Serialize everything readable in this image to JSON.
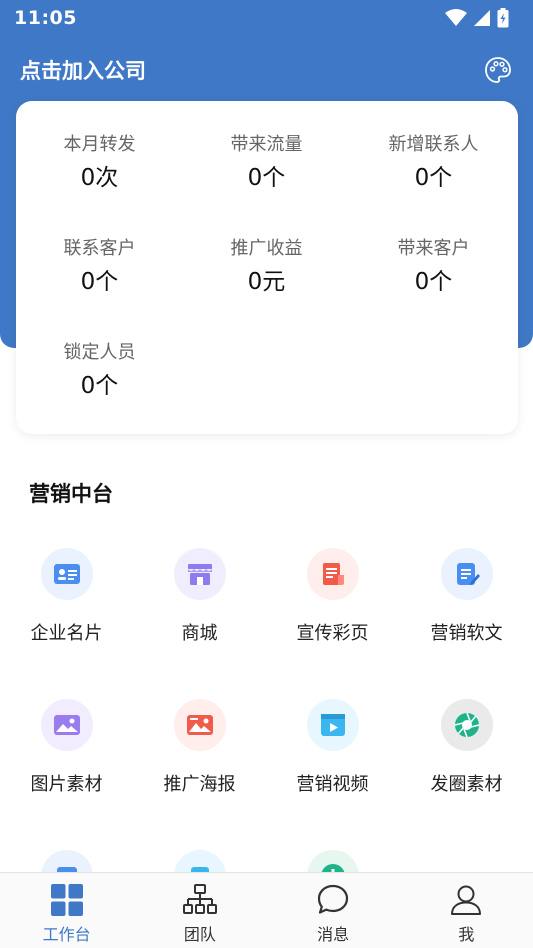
{
  "status": {
    "time": "11:05"
  },
  "header": {
    "title": "点击加入公司",
    "palette_icon": "palette-icon",
    "bg_color": "#3f78c6"
  },
  "stats": [
    {
      "label": "本月转发",
      "value": "0次"
    },
    {
      "label": "带来流量",
      "value": "0个"
    },
    {
      "label": "新增联系人",
      "value": "0个"
    },
    {
      "label": "联系客户",
      "value": "0个"
    },
    {
      "label": "推广收益",
      "value": "0元"
    },
    {
      "label": "带来客户",
      "value": "0个"
    },
    {
      "label": "锁定人员",
      "value": "0个"
    }
  ],
  "marketing": {
    "title": "营销中台",
    "items": [
      {
        "label": "企业名片",
        "icon": "business-card-icon",
        "color": "#4a8ff0"
      },
      {
        "label": "商城",
        "icon": "shop-icon",
        "color": "#8c7cf0"
      },
      {
        "label": "宣传彩页",
        "icon": "brochure-icon",
        "color": "#f25a4a"
      },
      {
        "label": "营销软文",
        "icon": "article-icon",
        "color": "#4a8ff0"
      },
      {
        "label": "图片素材",
        "icon": "image-icon",
        "color": "#9b7cf0"
      },
      {
        "label": "推广海报",
        "icon": "poster-icon",
        "color": "#f25a4a"
      },
      {
        "label": "营销视频",
        "icon": "video-icon",
        "color": "#3cb6f0"
      },
      {
        "label": "发圈素材",
        "icon": "aperture-icon",
        "color": "#1fb38a"
      },
      {
        "label": "",
        "icon": "partial-icon-1",
        "color": "#4a8ff0"
      },
      {
        "label": "",
        "icon": "partial-icon-2",
        "color": "#3cb6f0"
      },
      {
        "label": "",
        "icon": "partial-icon-3",
        "color": "#1fb38a"
      }
    ]
  },
  "nav": {
    "items": [
      {
        "label": "工作台",
        "icon": "workbench-icon",
        "active": true
      },
      {
        "label": "团队",
        "icon": "team-icon",
        "active": false
      },
      {
        "label": "消息",
        "icon": "message-icon",
        "active": false
      },
      {
        "label": "我",
        "icon": "profile-icon",
        "active": false
      }
    ],
    "active_color": "#3f78c6"
  }
}
